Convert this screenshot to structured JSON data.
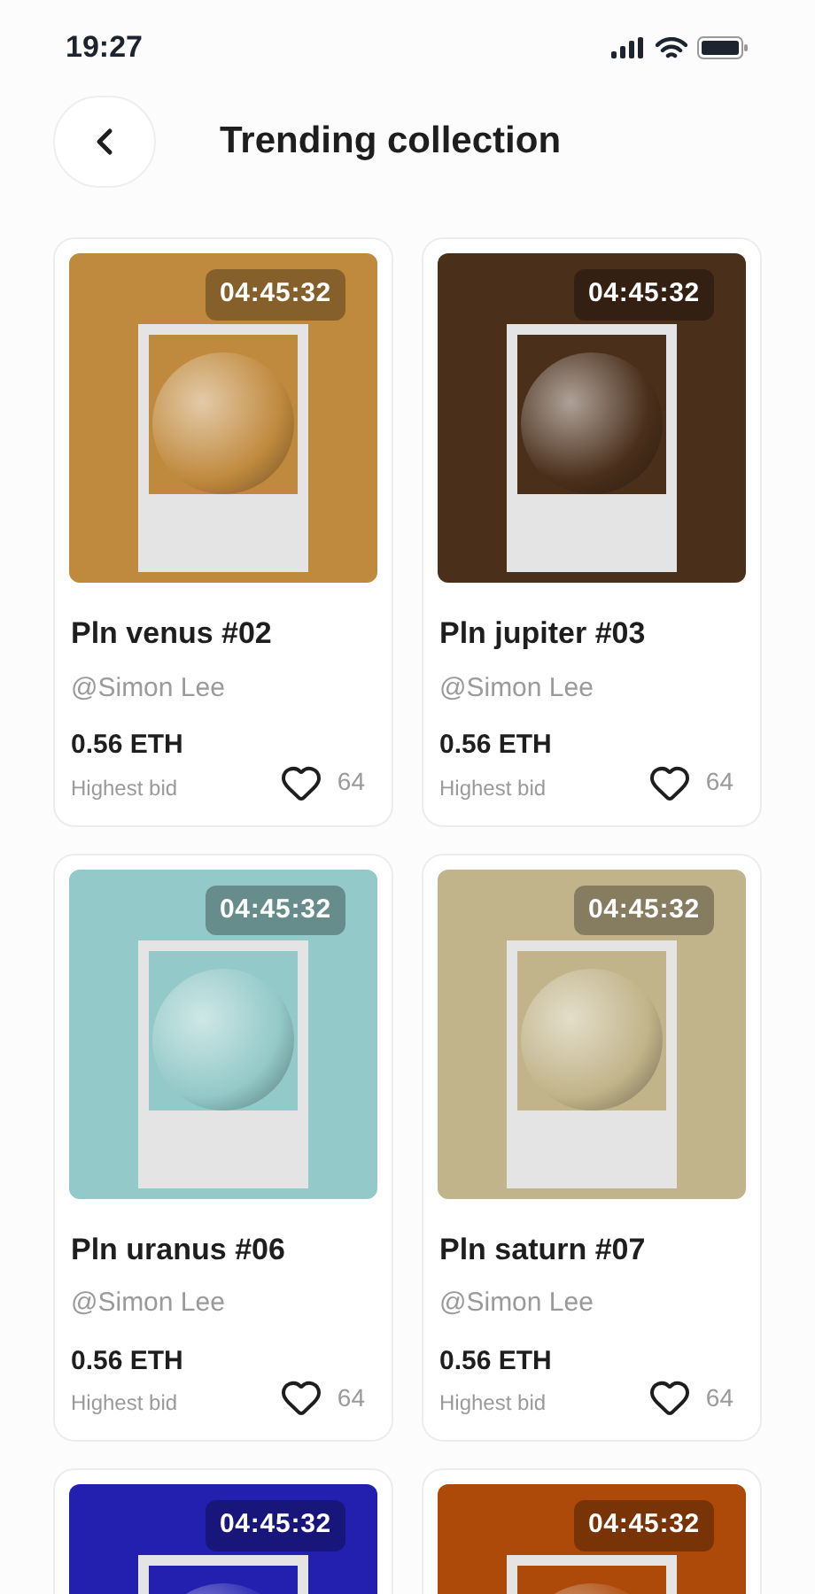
{
  "status_bar": {
    "time": "19:27"
  },
  "header": {
    "title": "Trending collection"
  },
  "cards": [
    {
      "timer": "04:45:32",
      "color": "#c08a3e",
      "title": "Pln venus #02",
      "author": "@Simon Lee",
      "price": "0.56 ETH",
      "price_label": "Highest bid",
      "likes": "64"
    },
    {
      "timer": "04:45:32",
      "color": "#4a2f1b",
      "title": "Pln jupiter #03",
      "author": "@Simon Lee",
      "price": "0.56 ETH",
      "price_label": "Highest bid",
      "likes": "64"
    },
    {
      "timer": "04:45:32",
      "color": "#93c9c8",
      "title": "Pln uranus #06",
      "author": "@Simon Lee",
      "price": "0.56 ETH",
      "price_label": "Highest bid",
      "likes": "64"
    },
    {
      "timer": "04:45:32",
      "color": "#c1b48a",
      "title": "Pln saturn #07",
      "author": "@Simon Lee",
      "price": "0.56 ETH",
      "price_label": "Highest bid",
      "likes": "64"
    },
    {
      "timer": "04:45:32",
      "color": "#2320b0"
    },
    {
      "timer": "04:45:32",
      "color": "#ad4a0a"
    }
  ]
}
